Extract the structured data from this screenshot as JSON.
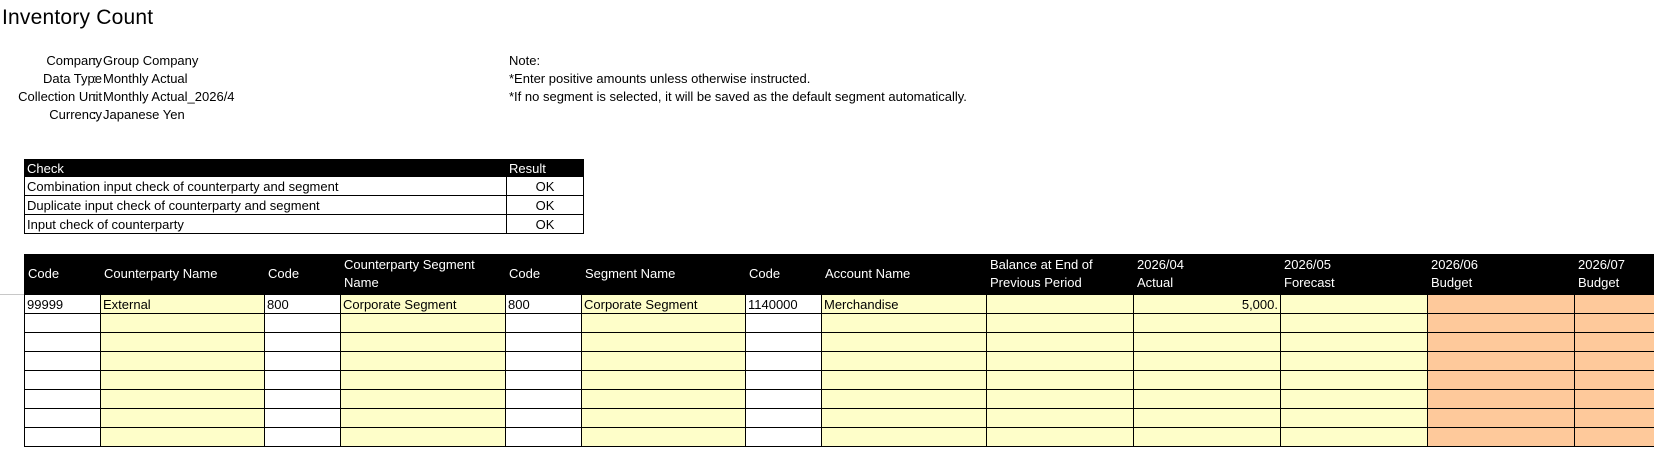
{
  "page": {
    "title": "Inventory Count"
  },
  "info": [
    {
      "label": "Company",
      "value": "Group Company"
    },
    {
      "label": "Data Type",
      "value": "Monthly Actual"
    },
    {
      "label": "Collection Unit",
      "value": "Monthly Actual_2026/4"
    },
    {
      "label": "Currency",
      "value": "Japanese Yen"
    }
  ],
  "info_colon": ":",
  "notes": [
    "Note:",
    "*Enter positive amounts unless otherwise instructed.",
    "*If no segment is selected, it will be saved as the default segment automatically."
  ],
  "check_table": {
    "headers": [
      "Check",
      "Result"
    ],
    "rows": [
      {
        "check": "Combination input check of counterparty and segment",
        "result": "OK"
      },
      {
        "check": "Duplicate input check of counterparty and segment",
        "result": "OK"
      },
      {
        "check": "Input check of counterparty",
        "result": "OK"
      }
    ]
  },
  "main_table": {
    "headers": [
      "Code",
      "Counterparty Name",
      "Code",
      "Counterparty Segment Name",
      "Code",
      "Segment Name",
      "Code",
      "Account Name",
      "Balance at End of Previous Period",
      "2026/04 Actual",
      "2026/05 Forecast",
      "2026/06 Budget",
      "2026/07 Budget"
    ],
    "header_lines": [
      [
        "Code"
      ],
      [
        "Counterparty Name"
      ],
      [
        "Code"
      ],
      [
        "Counterparty Segment",
        "Name"
      ],
      [
        "Code"
      ],
      [
        "Segment Name"
      ],
      [
        "Code"
      ],
      [
        "Account Name"
      ],
      [
        "Balance at End of",
        "Previous Period"
      ],
      [
        "2026/04",
        "Actual"
      ],
      [
        "2026/05",
        "Forecast"
      ],
      [
        "2026/06",
        "Budget"
      ],
      [
        "2026/07",
        "Budget"
      ]
    ],
    "rows": [
      [
        "99999",
        "External",
        "800",
        "Corporate Segment",
        "800",
        "Corporate Segment",
        "1140000",
        "Merchandise",
        "",
        "5,000.",
        "",
        "",
        ""
      ],
      [
        "",
        "",
        "",
        "",
        "",
        "",
        "",
        "",
        "",
        "",
        "",
        "",
        ""
      ],
      [
        "",
        "",
        "",
        "",
        "",
        "",
        "",
        "",
        "",
        "",
        "",
        "",
        ""
      ],
      [
        "",
        "",
        "",
        "",
        "",
        "",
        "",
        "",
        "",
        "",
        "",
        "",
        ""
      ],
      [
        "",
        "",
        "",
        "",
        "",
        "",
        "",
        "",
        "",
        "",
        "",
        "",
        ""
      ],
      [
        "",
        "",
        "",
        "",
        "",
        "",
        "",
        "",
        "",
        "",
        "",
        "",
        ""
      ],
      [
        "",
        "",
        "",
        "",
        "",
        "",
        "",
        "",
        "",
        "",
        "",
        "",
        ""
      ],
      [
        "",
        "",
        "",
        "",
        "",
        "",
        "",
        "",
        "",
        "",
        "",
        "",
        ""
      ]
    ],
    "column_colors": [
      "white",
      "yellow",
      "white",
      "yellow",
      "white",
      "yellow",
      "white",
      "yellow",
      "yellow",
      "yellow",
      "yellow",
      "orange",
      "orange"
    ],
    "colors": {
      "header_bg": "#000000",
      "header_text": "#ffffff",
      "input_yellow": "#fefec9",
      "budget_orange": "#fec99b"
    }
  }
}
